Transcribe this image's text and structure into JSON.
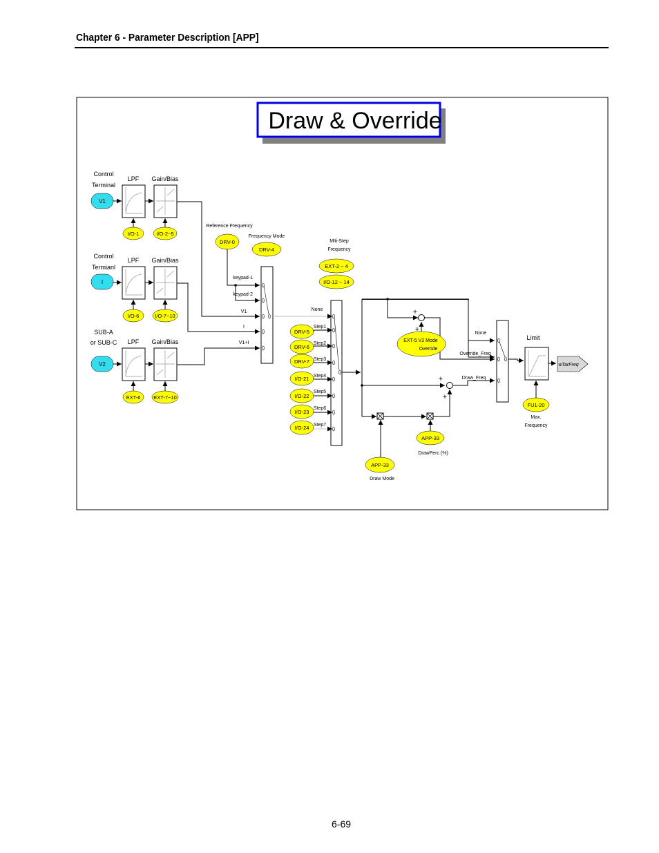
{
  "header": {
    "title": "Chapter 6 - Parameter Description [APP]"
  },
  "footer": {
    "page_number": "6-69"
  },
  "diagram": {
    "title": "Draw & Override",
    "colors": {
      "title_border": "#0000ee",
      "param_fill": "#ffff00",
      "input_fill": "#33ddee",
      "output_fill": "#d8d8d8",
      "shadow": "#808080"
    },
    "inputs": [
      {
        "source_label_1": "Control",
        "source_label_2": "Terminal",
        "terminal": "V1",
        "lpf_label": "LPF",
        "gain_label": "Gain/Bias",
        "lpf_param": "I/O-1",
        "gain_param": "I/O-2~5"
      },
      {
        "source_label_1": "Control",
        "source_label_2": "Termianl",
        "terminal": "I",
        "lpf_label": "LPF",
        "gain_label": "Gain/Bias",
        "lpf_param": "I/O-6",
        "gain_param": "I/O-7~10"
      },
      {
        "source_label_1": "SUB-A",
        "source_label_2": "or SUB-C",
        "terminal": "V2",
        "lpf_label": "LPF",
        "gain_label": "Gain/Bias",
        "lpf_param": "EXT-6",
        "gain_param": "EXT-7~10"
      }
    ],
    "reference": {
      "label": "Reference Frequency",
      "param": "DRV-0"
    },
    "freq_mode": {
      "label": "Frequency Mode",
      "param": "DRV-4"
    },
    "mode_switch_inputs": [
      "keypad-1",
      "keypad-2",
      "V1",
      "I",
      "V1+I"
    ],
    "multistep": {
      "label_1": "Mlti-Step",
      "label_2": "Frequency",
      "params": [
        "EXT-2 ~ 4",
        "I/O-12 ~ 14"
      ]
    },
    "step_switch_inputs": [
      "None",
      "Step1",
      "Step2",
      "Step3",
      "Step4",
      "Step5",
      "Step6",
      "Step7"
    ],
    "step_params": [
      "DRV-5",
      "DRV-6",
      "DRV-7",
      "I/O-21",
      "I/O-22",
      "I/O-23",
      "I/O-24"
    ],
    "override": {
      "param_line1": "EXT-5  V2  Mode",
      "param_line2": "Override"
    },
    "plus_sign": "+",
    "final_switch_inputs": [
      "None",
      "Override_Freq",
      "Draw_Freq"
    ],
    "draw_perc": {
      "param": "APP-33",
      "label": "DrawPerc (%)"
    },
    "draw_mode": {
      "param": "APP-33",
      "label": "Draw Mode"
    },
    "limit": {
      "label": "Limit",
      "param": "FU1-20",
      "param_label_1": "Max.",
      "param_label_2": "Frequency"
    },
    "output": {
      "label": "wTarFreq"
    }
  }
}
